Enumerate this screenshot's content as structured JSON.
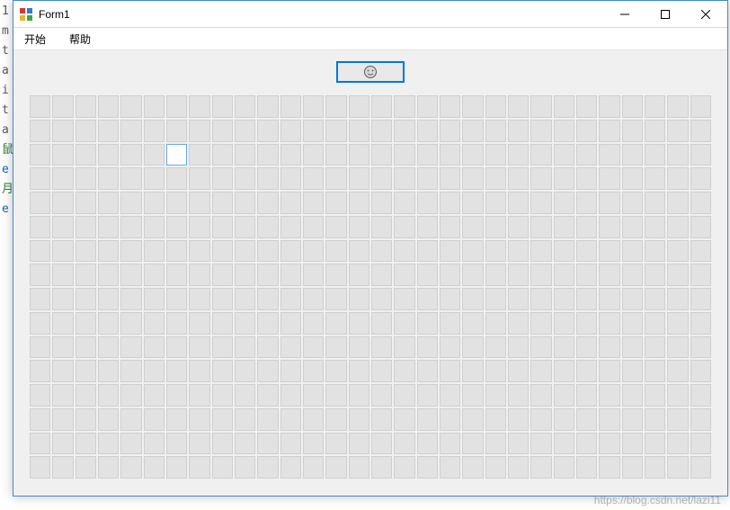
{
  "window": {
    "title": "Form1"
  },
  "menu": {
    "items": [
      "开始",
      "帮助"
    ]
  },
  "game": {
    "columns": 30,
    "rows": 16,
    "revealed_cells": [
      {
        "row": 2,
        "col": 6
      }
    ]
  },
  "gutter": [
    "1",
    "m",
    "",
    "t",
    "a",
    "i",
    "t",
    "a",
    "",
    "",
    "鼠",
    "e",
    "",
    "月",
    "e"
  ],
  "watermark": "https://blog.csdn.net/lazi11"
}
